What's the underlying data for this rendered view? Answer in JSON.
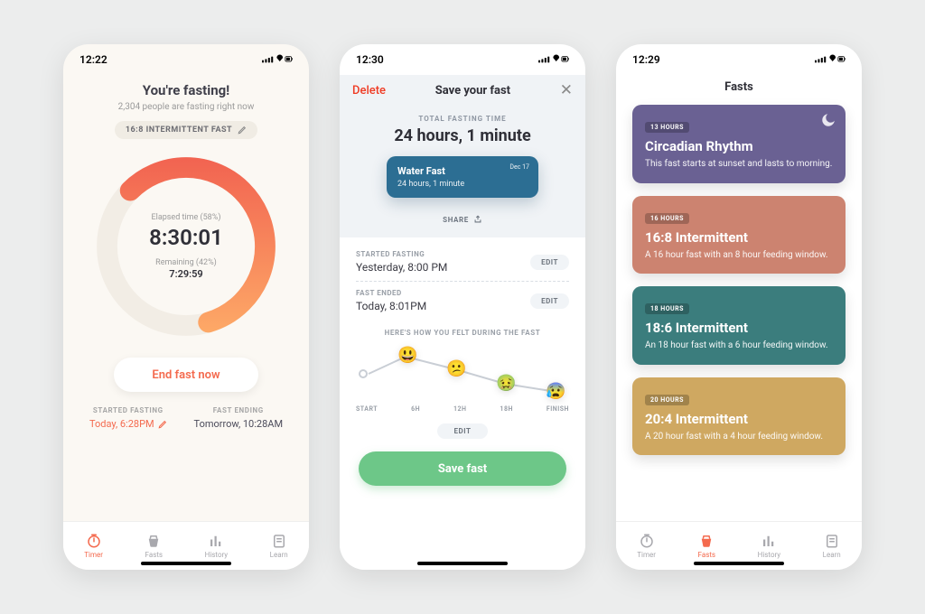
{
  "statusbar": {
    "t1": "12:22",
    "t2": "12:30",
    "t3": "12:29"
  },
  "tabbar": {
    "items": [
      {
        "icon": "timer-icon",
        "label": "Timer"
      },
      {
        "icon": "fasts-icon",
        "label": "Fasts"
      },
      {
        "icon": "history-icon",
        "label": "History"
      },
      {
        "icon": "learn-icon",
        "label": "Learn"
      }
    ]
  },
  "s1": {
    "title": "You're fasting!",
    "subtitle": "2,304 people are fasting right now",
    "chip": "16:8 INTERMITTENT FAST",
    "elapsed_label": "Elapsed time (58%)",
    "elapsed_value": "8:30:01",
    "remaining_label": "Remaining  (42%)",
    "remaining_value": "7:29:59",
    "end_button": "End fast now",
    "started_h": "STARTED FASTING",
    "started_v": "Today, 6:28PM",
    "ending_h": "FAST ENDING",
    "ending_v": "Tomorrow, 10:28AM"
  },
  "s2": {
    "delete": "Delete",
    "navtitle": "Save your fast",
    "close": "✕",
    "total_h": "TOTAL FASTING TIME",
    "total_v": "24 hours, 1 minute",
    "card_title": "Water Fast",
    "card_sub": "24 hours, 1 minute",
    "card_date": "Dec 17",
    "share": "SHARE",
    "started_h": "STARTED FASTING",
    "started_v": "Yesterday, 8:00 PM",
    "ended_h": "FAST ENDED",
    "ended_v": "Today, 8:01PM",
    "edit": "EDIT",
    "feel_h": "HERE'S HOW YOU FELT DURING THE FAST",
    "axis": [
      "START",
      "6H",
      "12H",
      "18H",
      "FINISH"
    ],
    "emojis": [
      "😃",
      "😕",
      "🤢",
      "😰"
    ],
    "save": "Save fast"
  },
  "s3": {
    "navtitle": "Fasts",
    "cards": [
      {
        "tag": "13 HOURS",
        "title": "Circadian Rhythm",
        "desc": "This fast starts at sunset and lasts to morning.",
        "class": "c-purple",
        "moon": true
      },
      {
        "tag": "16 HOURS",
        "title": "16:8 Intermittent",
        "desc": "A 16 hour fast with an 8 hour feeding window.",
        "class": "c-coral"
      },
      {
        "tag": "18 HOURS",
        "title": "18:6 Intermittent",
        "desc": "An 18 hour fast with a 6 hour feeding window.",
        "class": "c-teal"
      },
      {
        "tag": "20 HOURS",
        "title": "20:4 Intermittent",
        "desc": "A 20 hour fast with a 4 hour feeding window.",
        "class": "c-gold"
      }
    ]
  },
  "chart_data": {
    "type": "line",
    "title": "Here's how you felt during the fast",
    "categories": [
      "START",
      "6H",
      "12H",
      "18H",
      "FINISH"
    ],
    "values": [
      0.9,
      0.65,
      0.4,
      0.25
    ],
    "ylim": [
      0,
      1
    ],
    "note": "values are approximate mood level (1 = best) at 6H, 12H, 18H, FINISH; START marker has no emoji"
  }
}
